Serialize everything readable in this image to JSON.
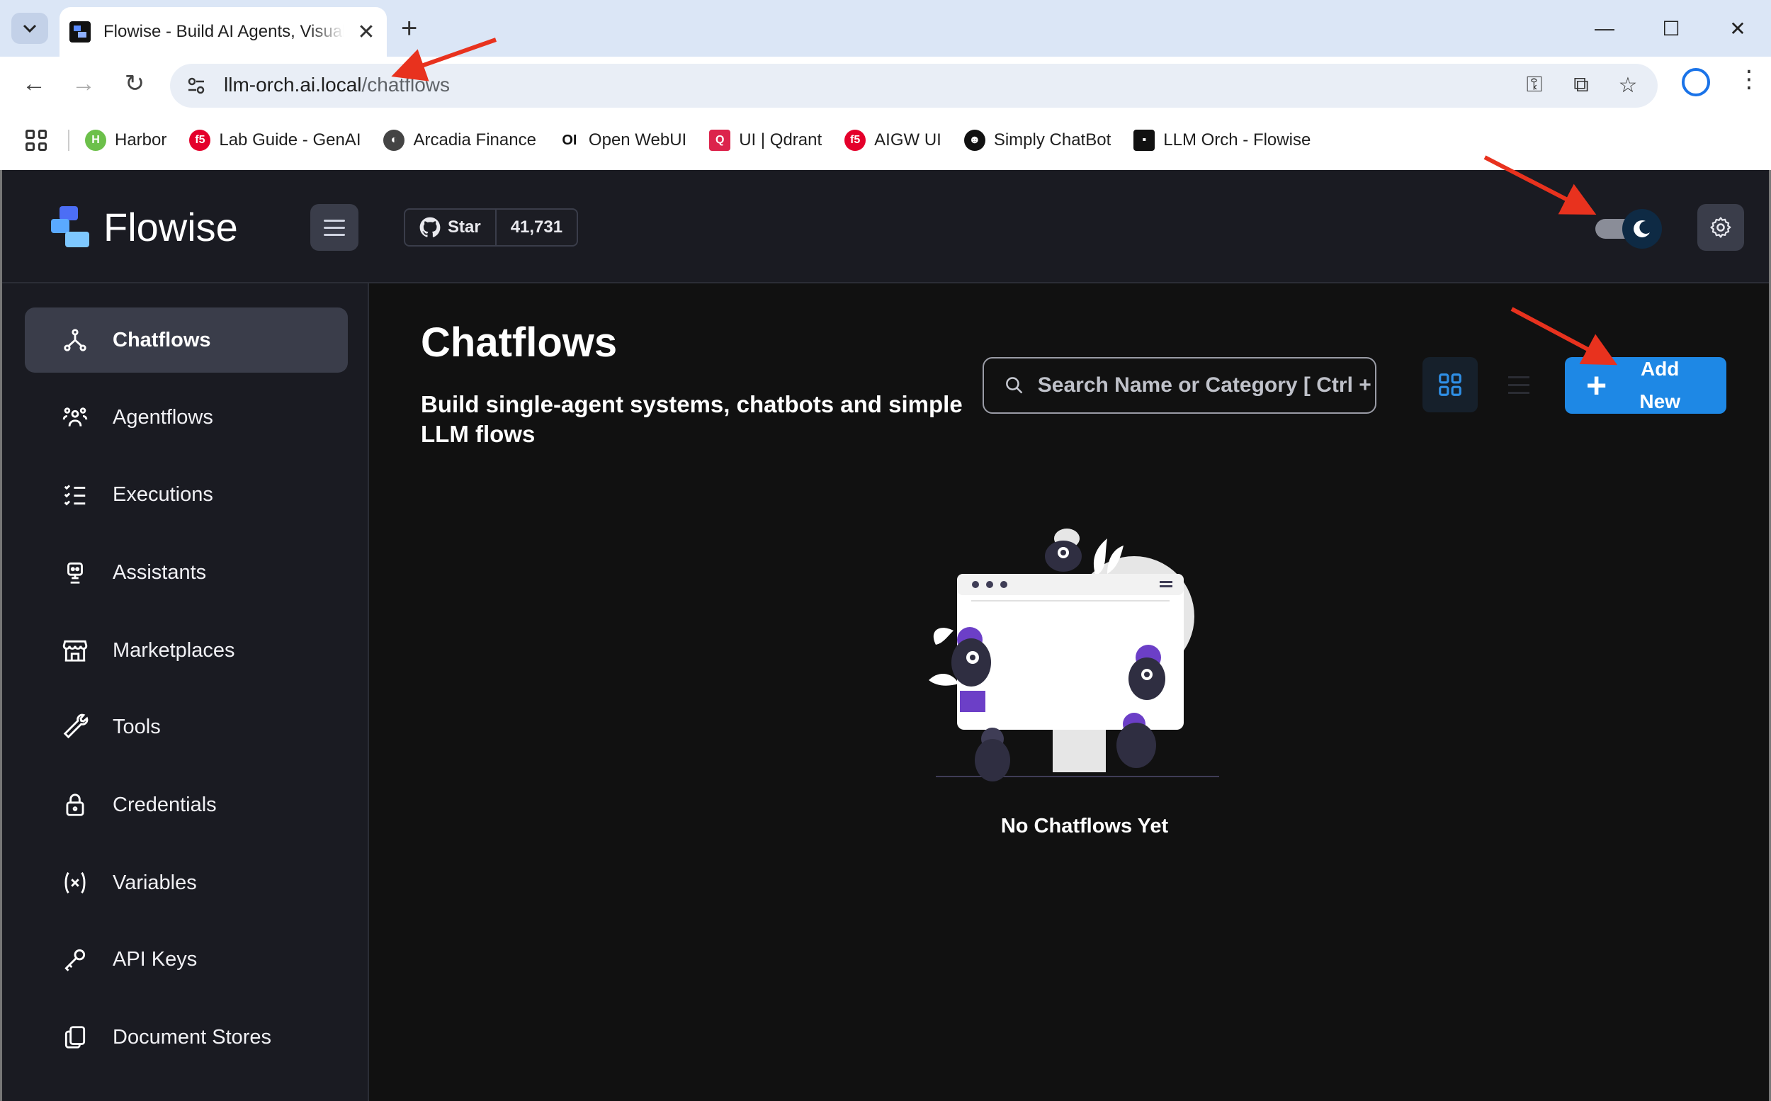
{
  "browser": {
    "tab_title": "Flowise - Build AI Agents, Visual LLM Apps",
    "url_host": "llm-orch.ai.local",
    "url_path": "/chatflows",
    "bookmarks": [
      {
        "label": "Harbor",
        "icon": "harbor-icon",
        "color": "#6cc04a"
      },
      {
        "label": "Lab Guide - GenAI",
        "icon": "f5-icon",
        "color": "#e4002b"
      },
      {
        "label": "Arcadia Finance",
        "icon": "globe-icon",
        "color": "#444444"
      },
      {
        "label": "Open WebUI",
        "icon": "openwebui-icon",
        "color": "#111111"
      },
      {
        "label": "UI | Qdrant",
        "icon": "qdrant-icon",
        "color": "#dc244c"
      },
      {
        "label": "AIGW UI",
        "icon": "f5-icon",
        "color": "#e4002b"
      },
      {
        "label": "Simply ChatBot",
        "icon": "chatbot-icon",
        "color": "#111111"
      },
      {
        "label": "LLM Orch - Flowise",
        "icon": "flowise-icon",
        "color": "#111111"
      }
    ]
  },
  "app": {
    "logo_text": "Flowise",
    "star_label": "Star",
    "star_count": "41,731",
    "theme": "dark"
  },
  "sidebar": {
    "items": [
      {
        "label": "Chatflows",
        "icon": "chatflows-icon",
        "active": true
      },
      {
        "label": "Agentflows",
        "icon": "agentflows-icon",
        "active": false
      },
      {
        "label": "Executions",
        "icon": "executions-icon",
        "active": false
      },
      {
        "label": "Assistants",
        "icon": "assistants-icon",
        "active": false
      },
      {
        "label": "Marketplaces",
        "icon": "marketplace-icon",
        "active": false
      },
      {
        "label": "Tools",
        "icon": "tools-icon",
        "active": false
      },
      {
        "label": "Credentials",
        "icon": "lock-icon",
        "active": false
      },
      {
        "label": "Variables",
        "icon": "variable-icon",
        "active": false
      },
      {
        "label": "API Keys",
        "icon": "key-icon",
        "active": false
      },
      {
        "label": "Document Stores",
        "icon": "documents-icon",
        "active": false
      }
    ]
  },
  "main": {
    "title": "Chatflows",
    "description": "Build single-agent systems, chatbots and simple LLM flows",
    "search_placeholder": "Search Name or Category [ Ctrl + F ]",
    "add_label": "Add New",
    "empty_text": "No Chatflows Yet"
  },
  "colors": {
    "accent": "#1e88e5",
    "annotation": "#e8321e",
    "illustration_purple": "#6c3fc7"
  }
}
